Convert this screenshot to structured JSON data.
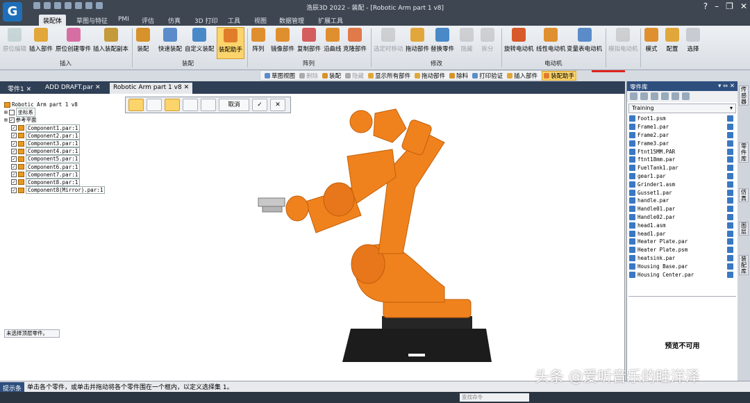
{
  "window": {
    "title": "浩辰3D 2022 - 装配 - [Robotic Arm part 1 v8]",
    "logo": "G"
  },
  "ribbon_tabs": [
    "装配体",
    "草图与特征",
    "PMI",
    "评估",
    "仿真",
    "3D 打印",
    "工具",
    "视图",
    "数据管理",
    "扩展工具"
  ],
  "ribbon": {
    "buttons": [
      "原位编辑",
      "插入部件",
      "原位创建零件",
      "插入装配副本",
      "装配",
      "快速装配",
      "自定义装配",
      "装配助手",
      "阵列",
      "镜像部件",
      "复制部件",
      "沿曲线",
      "克隆部件",
      "选定时移动",
      "拖动部件",
      "替换零件",
      "隐藏",
      "拆分",
      "旋转电动机",
      "线性电动机",
      "变量表电动机",
      "模拟电动机",
      "模式",
      "配置",
      "选择"
    ],
    "groups": [
      "插入",
      "装配",
      "阵列",
      "修改",
      "电动机"
    ]
  },
  "toolbar2": [
    "草图视图",
    "删除",
    "装配",
    "隐藏",
    "显示所有部件",
    "拖动部件",
    "除料",
    "打印验证",
    "插入部件",
    "装配助手"
  ],
  "doc_tabs": [
    "零件1",
    "ADD DRAFT.par",
    "Robotic Arm part 1 v8"
  ],
  "tree": {
    "root": "Robotic Arm part 1 v8",
    "coord": "坐标系",
    "refplane": "参考平面",
    "components": [
      "Component1.par:1",
      "Component2.par:1",
      "Component3.par:1",
      "Component4.par:1",
      "Component5.par:1",
      "Component6.par:1",
      "Component7.par:1",
      "Component8.par:1",
      "Component8(Mirror).par:1"
    ]
  },
  "command_bar": {
    "cancel": "取消"
  },
  "select_status": "未选择顶层零件。",
  "library": {
    "title": "零件库",
    "folder": "Training",
    "files": [
      "Foot1.psm",
      "Frame1.par",
      "Frame2.par",
      "Frame3.par",
      "Ftnt15MM.PAR",
      "ftnt18mm.par",
      "FuelTank1.par",
      "gear1.par",
      "Grinder1.asm",
      "Gusset1.par",
      "handle.par",
      "Handle01.par",
      "Handle02.par",
      "head1.asm",
      "head1.par",
      "Heater Plate.par",
      "Heater Plate.psm",
      "heatsink.par",
      "Housing Base.par",
      "Housing Center.par"
    ],
    "preview": "预览不可用"
  },
  "side_tabs": [
    "传感器",
    "零件库",
    "仿真",
    "图层",
    "装配库"
  ],
  "prompt": {
    "label": "提示条",
    "text": "单击各个零件，或单击并拖动将各个零件围在一个框内，以定义选择集 1。"
  },
  "command_placeholder": "查找命令",
  "watermark": "头条 @爱听音乐的眭洋泽",
  "colors": {
    "arm": "#f0821e",
    "base": "#1c1c1c",
    "accent": "#fbd46b"
  }
}
